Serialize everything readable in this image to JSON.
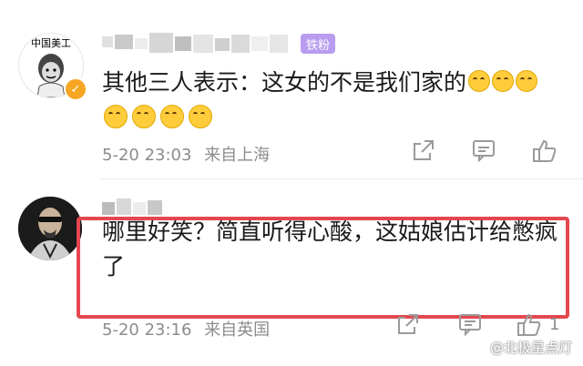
{
  "comments": [
    {
      "avatar_text": "中国美工",
      "fan_badge": "铁粉",
      "text": "其他三人表示：这女的不是我们家的",
      "inline_emojis": 3,
      "extra_emojis": 4,
      "time": "5-20 23:03",
      "location": "来自上海",
      "verified": true
    },
    {
      "text": "哪里好笑？简直听得心酸，这姑娘估计给憋疯了",
      "time": "5-20 23:16",
      "location": "来自英国",
      "like_count": "1",
      "highlighted": true
    }
  ],
  "watermark": "@北极星点灯",
  "colors": {
    "highlight": "#e4474f",
    "verified": "#f6a623"
  }
}
